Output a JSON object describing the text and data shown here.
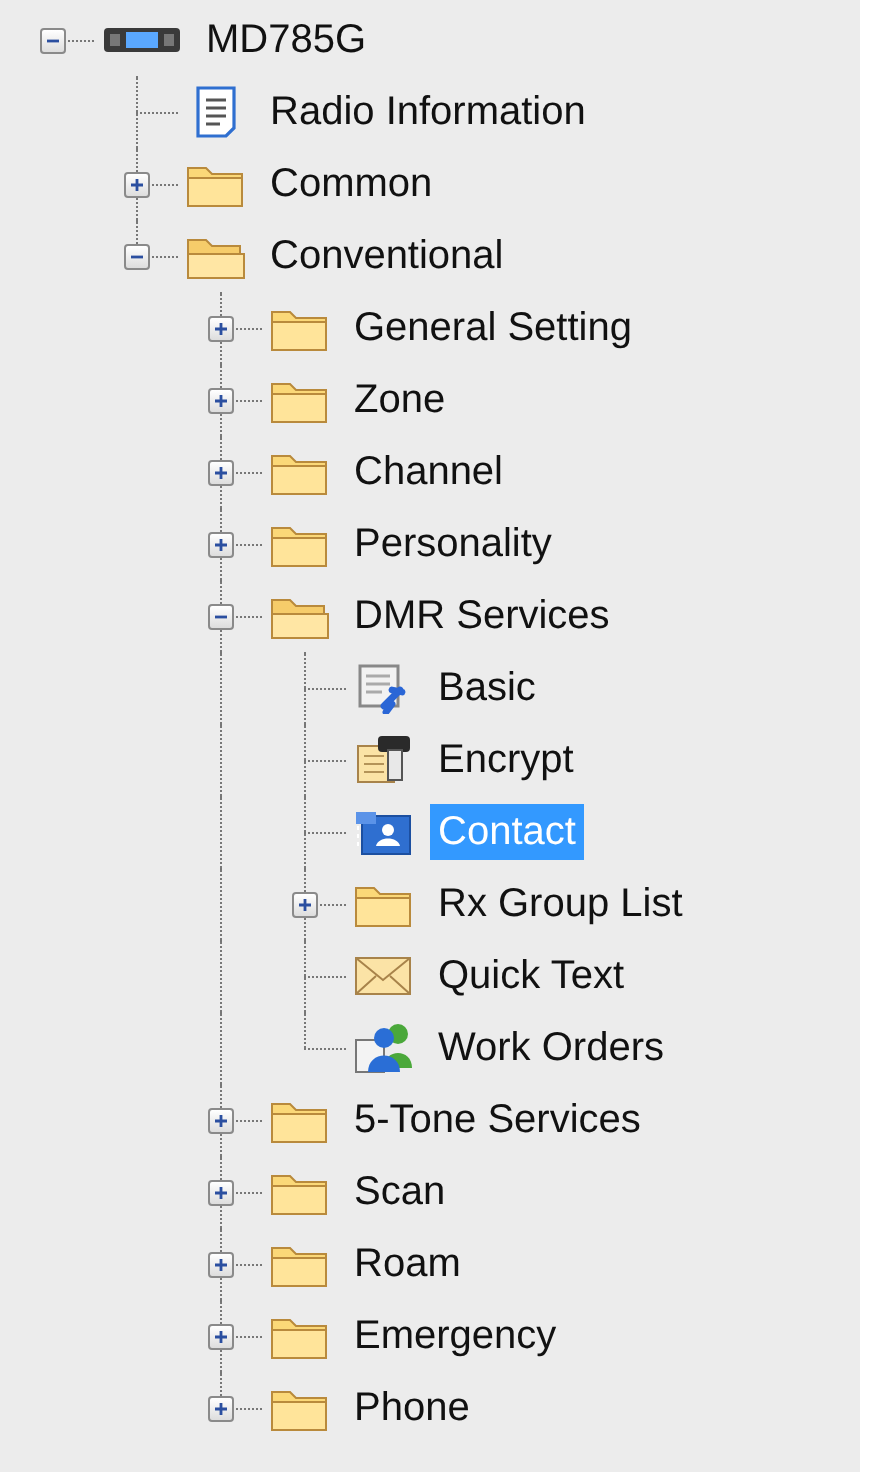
{
  "tree": [
    {
      "label": "MD785G",
      "kind": "radio",
      "expanded": true,
      "selected": false,
      "children": [
        {
          "label": "Radio Information",
          "kind": "document",
          "selected": false
        },
        {
          "label": "Common",
          "kind": "folder",
          "expanded": false,
          "selected": false
        },
        {
          "label": "Conventional",
          "kind": "folder",
          "expanded": true,
          "selected": false,
          "children": [
            {
              "label": "General Setting",
              "kind": "folder",
              "expanded": false,
              "selected": false
            },
            {
              "label": "Zone",
              "kind": "folder",
              "expanded": false,
              "selected": false
            },
            {
              "label": "Channel",
              "kind": "folder",
              "expanded": false,
              "selected": false
            },
            {
              "label": "Personality",
              "kind": "folder",
              "expanded": false,
              "selected": false
            },
            {
              "label": "DMR Services",
              "kind": "folder",
              "expanded": true,
              "selected": false,
              "children": [
                {
                  "label": "Basic",
                  "kind": "settings",
                  "selected": false
                },
                {
                  "label": "Encrypt",
                  "kind": "key",
                  "selected": false
                },
                {
                  "label": "Contact",
                  "kind": "contact",
                  "selected": true
                },
                {
                  "label": "Rx Group List",
                  "kind": "folder",
                  "expanded": false,
                  "selected": false
                },
                {
                  "label": "Quick Text",
                  "kind": "mail",
                  "selected": false
                },
                {
                  "label": "Work Orders",
                  "kind": "people",
                  "selected": false
                }
              ]
            },
            {
              "label": "5-Tone Services",
              "kind": "folder",
              "expanded": false,
              "selected": false
            },
            {
              "label": "Scan",
              "kind": "folder",
              "expanded": false,
              "selected": false
            },
            {
              "label": "Roam",
              "kind": "folder",
              "expanded": false,
              "selected": false
            },
            {
              "label": "Emergency",
              "kind": "folder",
              "expanded": false,
              "selected": false
            },
            {
              "label": "Phone",
              "kind": "folder",
              "expanded": false,
              "selected": false
            }
          ]
        }
      ]
    }
  ]
}
